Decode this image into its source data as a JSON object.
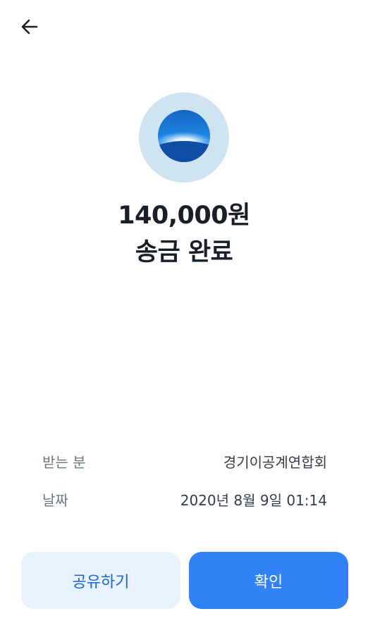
{
  "header": {
    "back_icon": "arrow-left-icon"
  },
  "bank": {
    "logo_icon": "bank-logo-icon",
    "logo_bg_color": "#cfe3f1",
    "logo_color": "#1a6fc6"
  },
  "result": {
    "amount": "140,000원",
    "status": "송금 완료"
  },
  "details": [
    {
      "label": "받는 분",
      "value": "경기이공계연합회"
    },
    {
      "label": "날짜",
      "value": "2020년 8월 9일 01:14"
    }
  ],
  "actions": {
    "share_label": "공유하기",
    "confirm_label": "확인"
  },
  "colors": {
    "accent": "#3182f6",
    "share_bg": "#e8f3ff",
    "share_text": "#1b64da"
  }
}
